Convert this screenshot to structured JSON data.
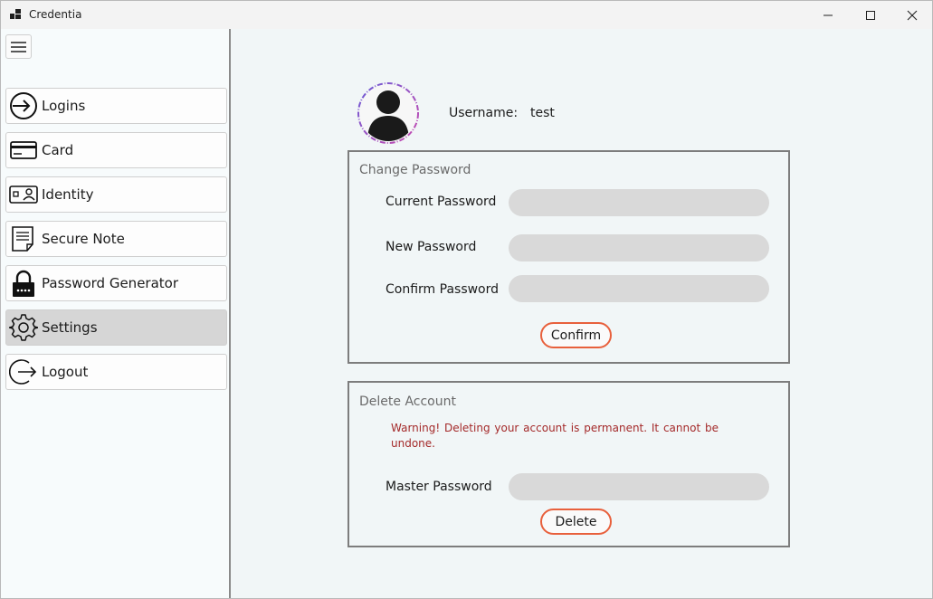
{
  "window": {
    "title": "Credentia"
  },
  "sidebar": {
    "items": [
      {
        "label": "Logins",
        "icon": "login-arrow-icon"
      },
      {
        "label": "Card",
        "icon": "credit-card-icon"
      },
      {
        "label": "Identity",
        "icon": "id-card-icon"
      },
      {
        "label": "Secure Note",
        "icon": "note-icon"
      },
      {
        "label": "Password Generator",
        "icon": "padlock-icon"
      },
      {
        "label": "Settings",
        "icon": "gear-icon",
        "active": true
      },
      {
        "label": "Logout",
        "icon": "logout-arrow-icon"
      }
    ]
  },
  "profile": {
    "username_label": "Username:",
    "username_value": "test"
  },
  "change_password": {
    "title": "Change Password",
    "current_label": "Current Password",
    "current_value": "",
    "new_label": "New Password",
    "new_value": "",
    "confirm_label": "Confirm Password",
    "confirm_value": "",
    "button": "Confirm"
  },
  "delete_account": {
    "title": "Delete Account",
    "warning": "Warning!  Deleting your account is permanent. It cannot be undone.",
    "master_label": "Master Password",
    "master_value": "",
    "button": "Delete"
  },
  "colors": {
    "accent_button_border": "#e8603c",
    "warning_text": "#a42a2a",
    "active_nav": "#d6d6d6",
    "input_fill": "#d9d9d9"
  }
}
